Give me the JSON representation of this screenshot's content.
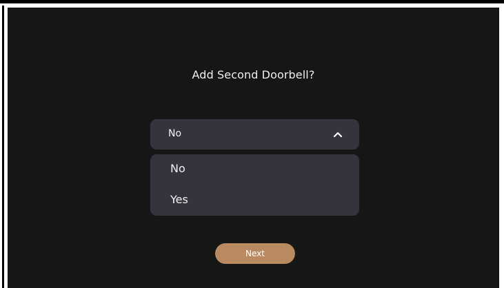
{
  "title": "Add Second Doorbell?",
  "dropdown": {
    "selected": "No",
    "expanded": true,
    "options": [
      {
        "label": "No"
      },
      {
        "label": "Yes"
      }
    ]
  },
  "next_button": {
    "label": "Next"
  },
  "colors": {
    "background": "#161616",
    "panel": "#34343e",
    "accent": "#b98a62",
    "text": "#f2f2f2"
  },
  "icons": {
    "dropdown_toggle": "chevron-up-icon"
  }
}
